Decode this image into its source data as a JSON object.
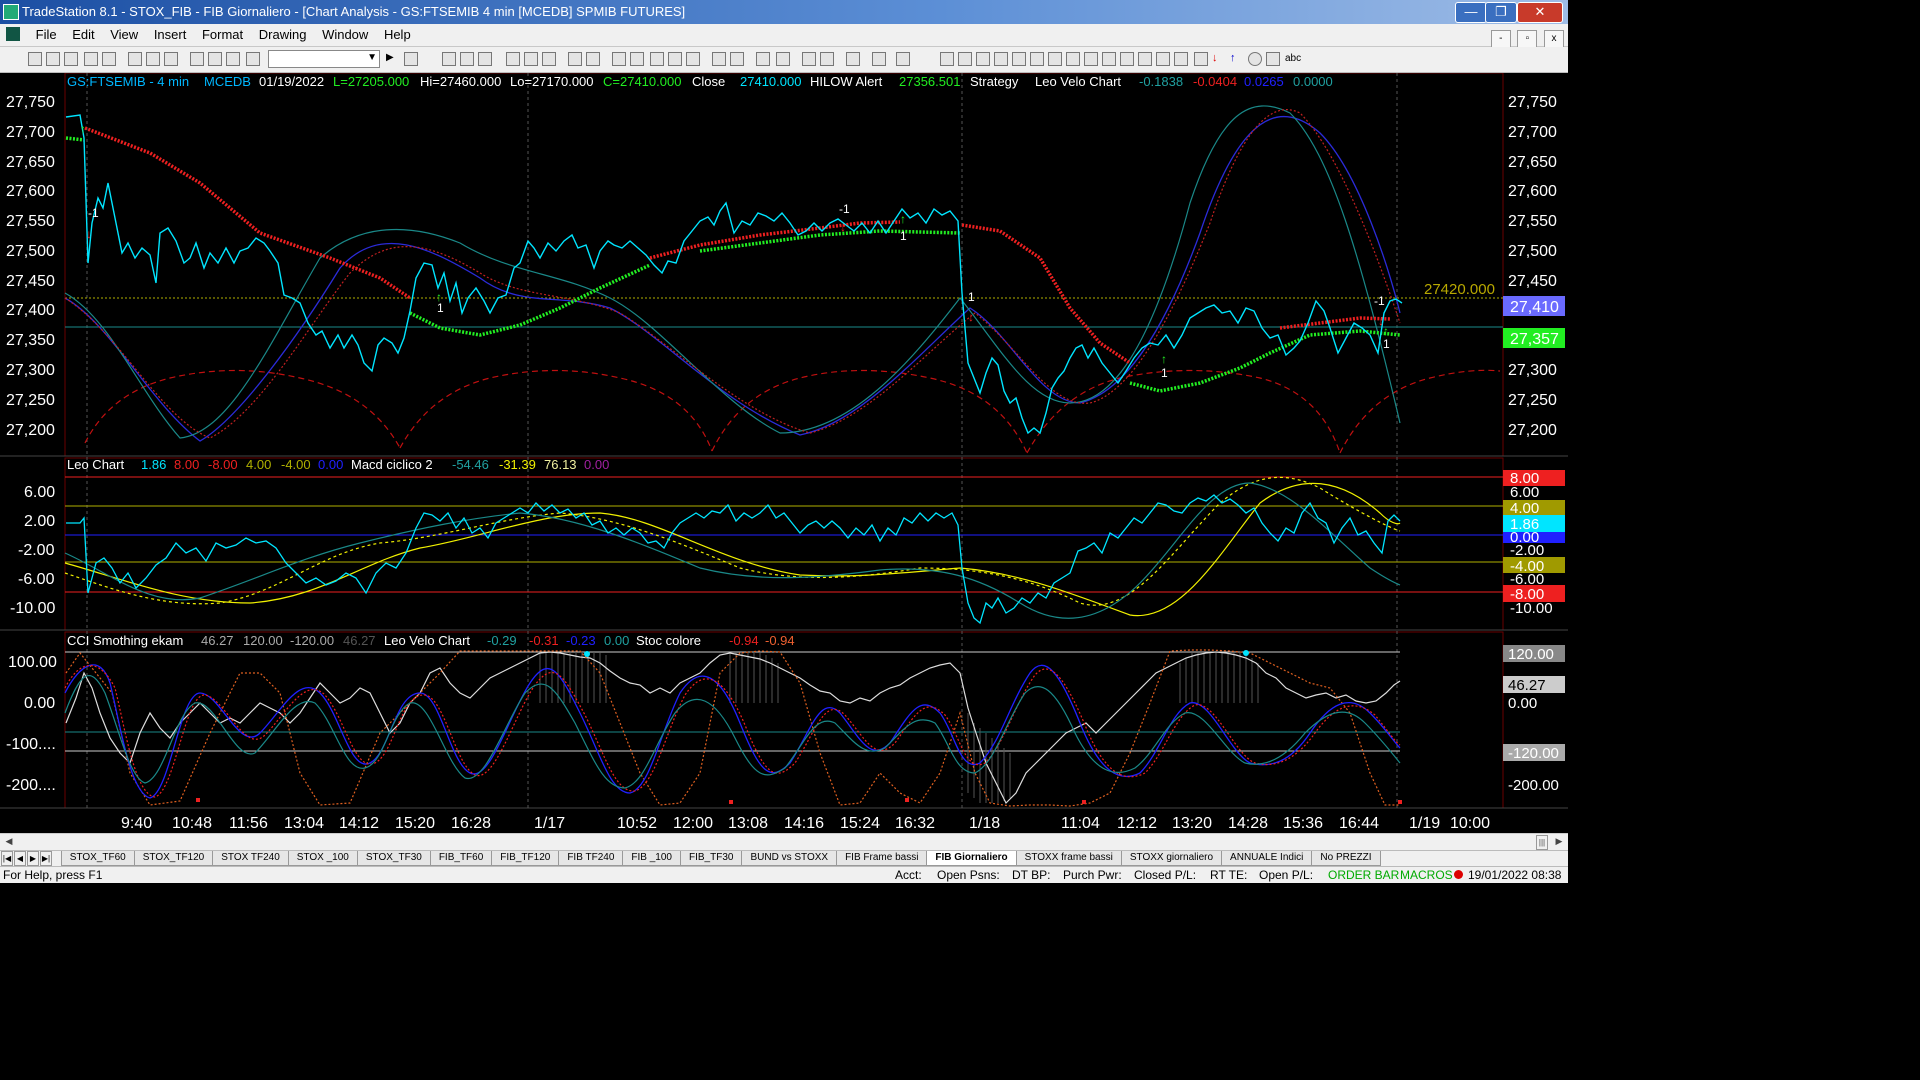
{
  "window": {
    "title": "TradeStation 8.1 - STOX_FIB - FIB Giornaliero - [Chart Analysis - GS:FTSEMIB  4 min  [MCEDB] SPMIB FUTURES]",
    "min_glyph": "—",
    "max_glyph": "❐",
    "close_glyph": "✕"
  },
  "menu": [
    "File",
    "Edit",
    "View",
    "Insert",
    "Format",
    "Drawing",
    "Window",
    "Help"
  ],
  "mdi": {
    "min": "-",
    "restore": "▫",
    "close": "x"
  },
  "toolbar": {
    "abc_label": "abc"
  },
  "header": {
    "symbol": "GS:FTSEMIB - 4 min",
    "feed": "MCEDB",
    "date": "01/19/2022",
    "low_open": "L=27205.000",
    "hi": "Hi=27460.000",
    "lo": "Lo=27170.000",
    "close_eq": "C=27410.000",
    "close_label": "Close",
    "close_val": "27410.000",
    "hilow_label": "HILOW Alert",
    "hilow_val": "27356.501",
    "strategy_label": "Strategy",
    "velo_label": "Leo Velo Chart",
    "v1": "-0.1838",
    "v2": "-0.0404",
    "v3": "0.0265",
    "v4": "0.0000"
  },
  "price_panel": {
    "y_labels": [
      "27,750",
      "27,700",
      "27,650",
      "27,600",
      "27,550",
      "27,500",
      "27,450",
      "27,400",
      "27,350",
      "27,300",
      "27,250",
      "27,200"
    ],
    "ref_level_label": "27420.000",
    "last_price_badge": "27,410",
    "hilow_badge": "27,357",
    "markers": [
      "-1",
      "1",
      "1",
      "-1",
      "1",
      "1",
      "1",
      "-1",
      "1"
    ]
  },
  "macd_panel": {
    "leo_label": "Leo Chart",
    "l1": "1.86",
    "l2": "8.00",
    "l3": "-8.00",
    "l4": "4.00",
    "l5": "-4.00",
    "l6": "0.00",
    "macd_label": "Macd ciclico 2",
    "m1": "-54.46",
    "m2": "-31.39",
    "m3": "76.13",
    "m4": "0.00",
    "y_labels": [
      "6.00",
      "2.00",
      "-2.00",
      "-6.00",
      "-10.00"
    ],
    "badges": {
      "b8": "8.00",
      "b6": "6.00",
      "b4": "4.00",
      "b186": "1.86",
      "b0": "0.00",
      "bm2": "-2.00",
      "bm4": "-4.00",
      "bm6": "-6.00",
      "bm8": "-8.00",
      "bm10": "-10.00"
    }
  },
  "cci_panel": {
    "cci_label": "CCI Smothing ekam",
    "c1": "46.27",
    "c2": "120.00",
    "c3": "-120.00",
    "c4": "46.27",
    "velo_label": "Leo Velo Chart",
    "v1": "-0.29",
    "v2": "-0.31",
    "v3": "-0.23",
    "v4": "0.00",
    "stoc_label": "Stoc colore",
    "s1": "-0.94",
    "s2": "-0.94",
    "y_labels": [
      "100.00",
      "0.00",
      "-100....",
      "-200...."
    ],
    "badges": {
      "b120": "120.00",
      "b4627": "46.27",
      "b0": "0.00",
      "bm120": "-120.00",
      "bm200": "-200.00"
    }
  },
  "time_axis": [
    "9:40",
    "10:48",
    "11:56",
    "13:04",
    "14:12",
    "15:20",
    "16:28",
    "1/17",
    "10:52",
    "12:00",
    "13:08",
    "14:16",
    "15:24",
    "16:32",
    "1/18",
    "11:04",
    "12:12",
    "13:20",
    "14:28",
    "15:36",
    "16:44",
    "1/19",
    "10:00"
  ],
  "tabs": [
    "STOX_TF60",
    "STOX_TF120",
    "STOX TF240",
    "STOX _100",
    "STOX_TF30",
    "FIB_TF60",
    "FIB_TF120",
    "FIB TF240",
    "FIB _100",
    "FIB_TF30",
    "BUND vs STOXX",
    "FIB Frame bassi",
    "FIB Giornaliero",
    "STOXX frame bassi",
    "STOXX giornaliero",
    "ANNUALE Indici",
    "No PREZZI"
  ],
  "active_tab": "FIB Giornaliero",
  "status": {
    "help": "For Help, press F1",
    "acct": "Acct:",
    "open_psns": "Open Psns:",
    "dt_bp": "DT BP:",
    "purch_pwr": "Purch Pwr:",
    "closed_pl": "Closed P/L:",
    "rt_te": "RT TE:",
    "open_pl": "Open P/L:",
    "order_bar": "ORDER BAR",
    "macros": "MACROS",
    "datetime": "19/01/2022 08:38"
  },
  "colors": {
    "bg": "#000000",
    "price": "#00e5ff",
    "up": "#22ee22",
    "down": "#ee2020",
    "axis_text": "#ffffff",
    "yellow": "#f0f000",
    "blue": "#2020ff",
    "teal": "#20a0a0"
  }
}
